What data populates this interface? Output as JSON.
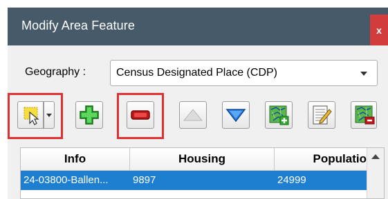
{
  "window": {
    "title": "Modify Area Feature",
    "close_label": "x"
  },
  "geography": {
    "label": "Geography :",
    "selected": "Census Designated Place (CDP)"
  },
  "toolbar": {
    "buttons": [
      {
        "name": "select-feature",
        "icon": "select-rectangle-icon"
      },
      {
        "name": "add",
        "icon": "green-plus-icon"
      },
      {
        "name": "remove",
        "icon": "red-minus-icon"
      },
      {
        "name": "move-up",
        "icon": "triangle-up-icon"
      },
      {
        "name": "move-down",
        "icon": "triangle-down-icon"
      },
      {
        "name": "map-add",
        "icon": "map-add-icon"
      },
      {
        "name": "map-edit",
        "icon": "map-edit-icon"
      },
      {
        "name": "map-remove",
        "icon": "map-remove-icon"
      }
    ]
  },
  "table": {
    "columns": [
      "Info",
      "Housing",
      "Populatio"
    ],
    "rows": [
      {
        "info": "24-03800-Ballen...",
        "housing": "9897",
        "population": "24999",
        "selected": true
      }
    ]
  },
  "colors": {
    "titlebar": "#465a6a",
    "selection": "#1e7fd0",
    "highlight": "#e03030"
  }
}
